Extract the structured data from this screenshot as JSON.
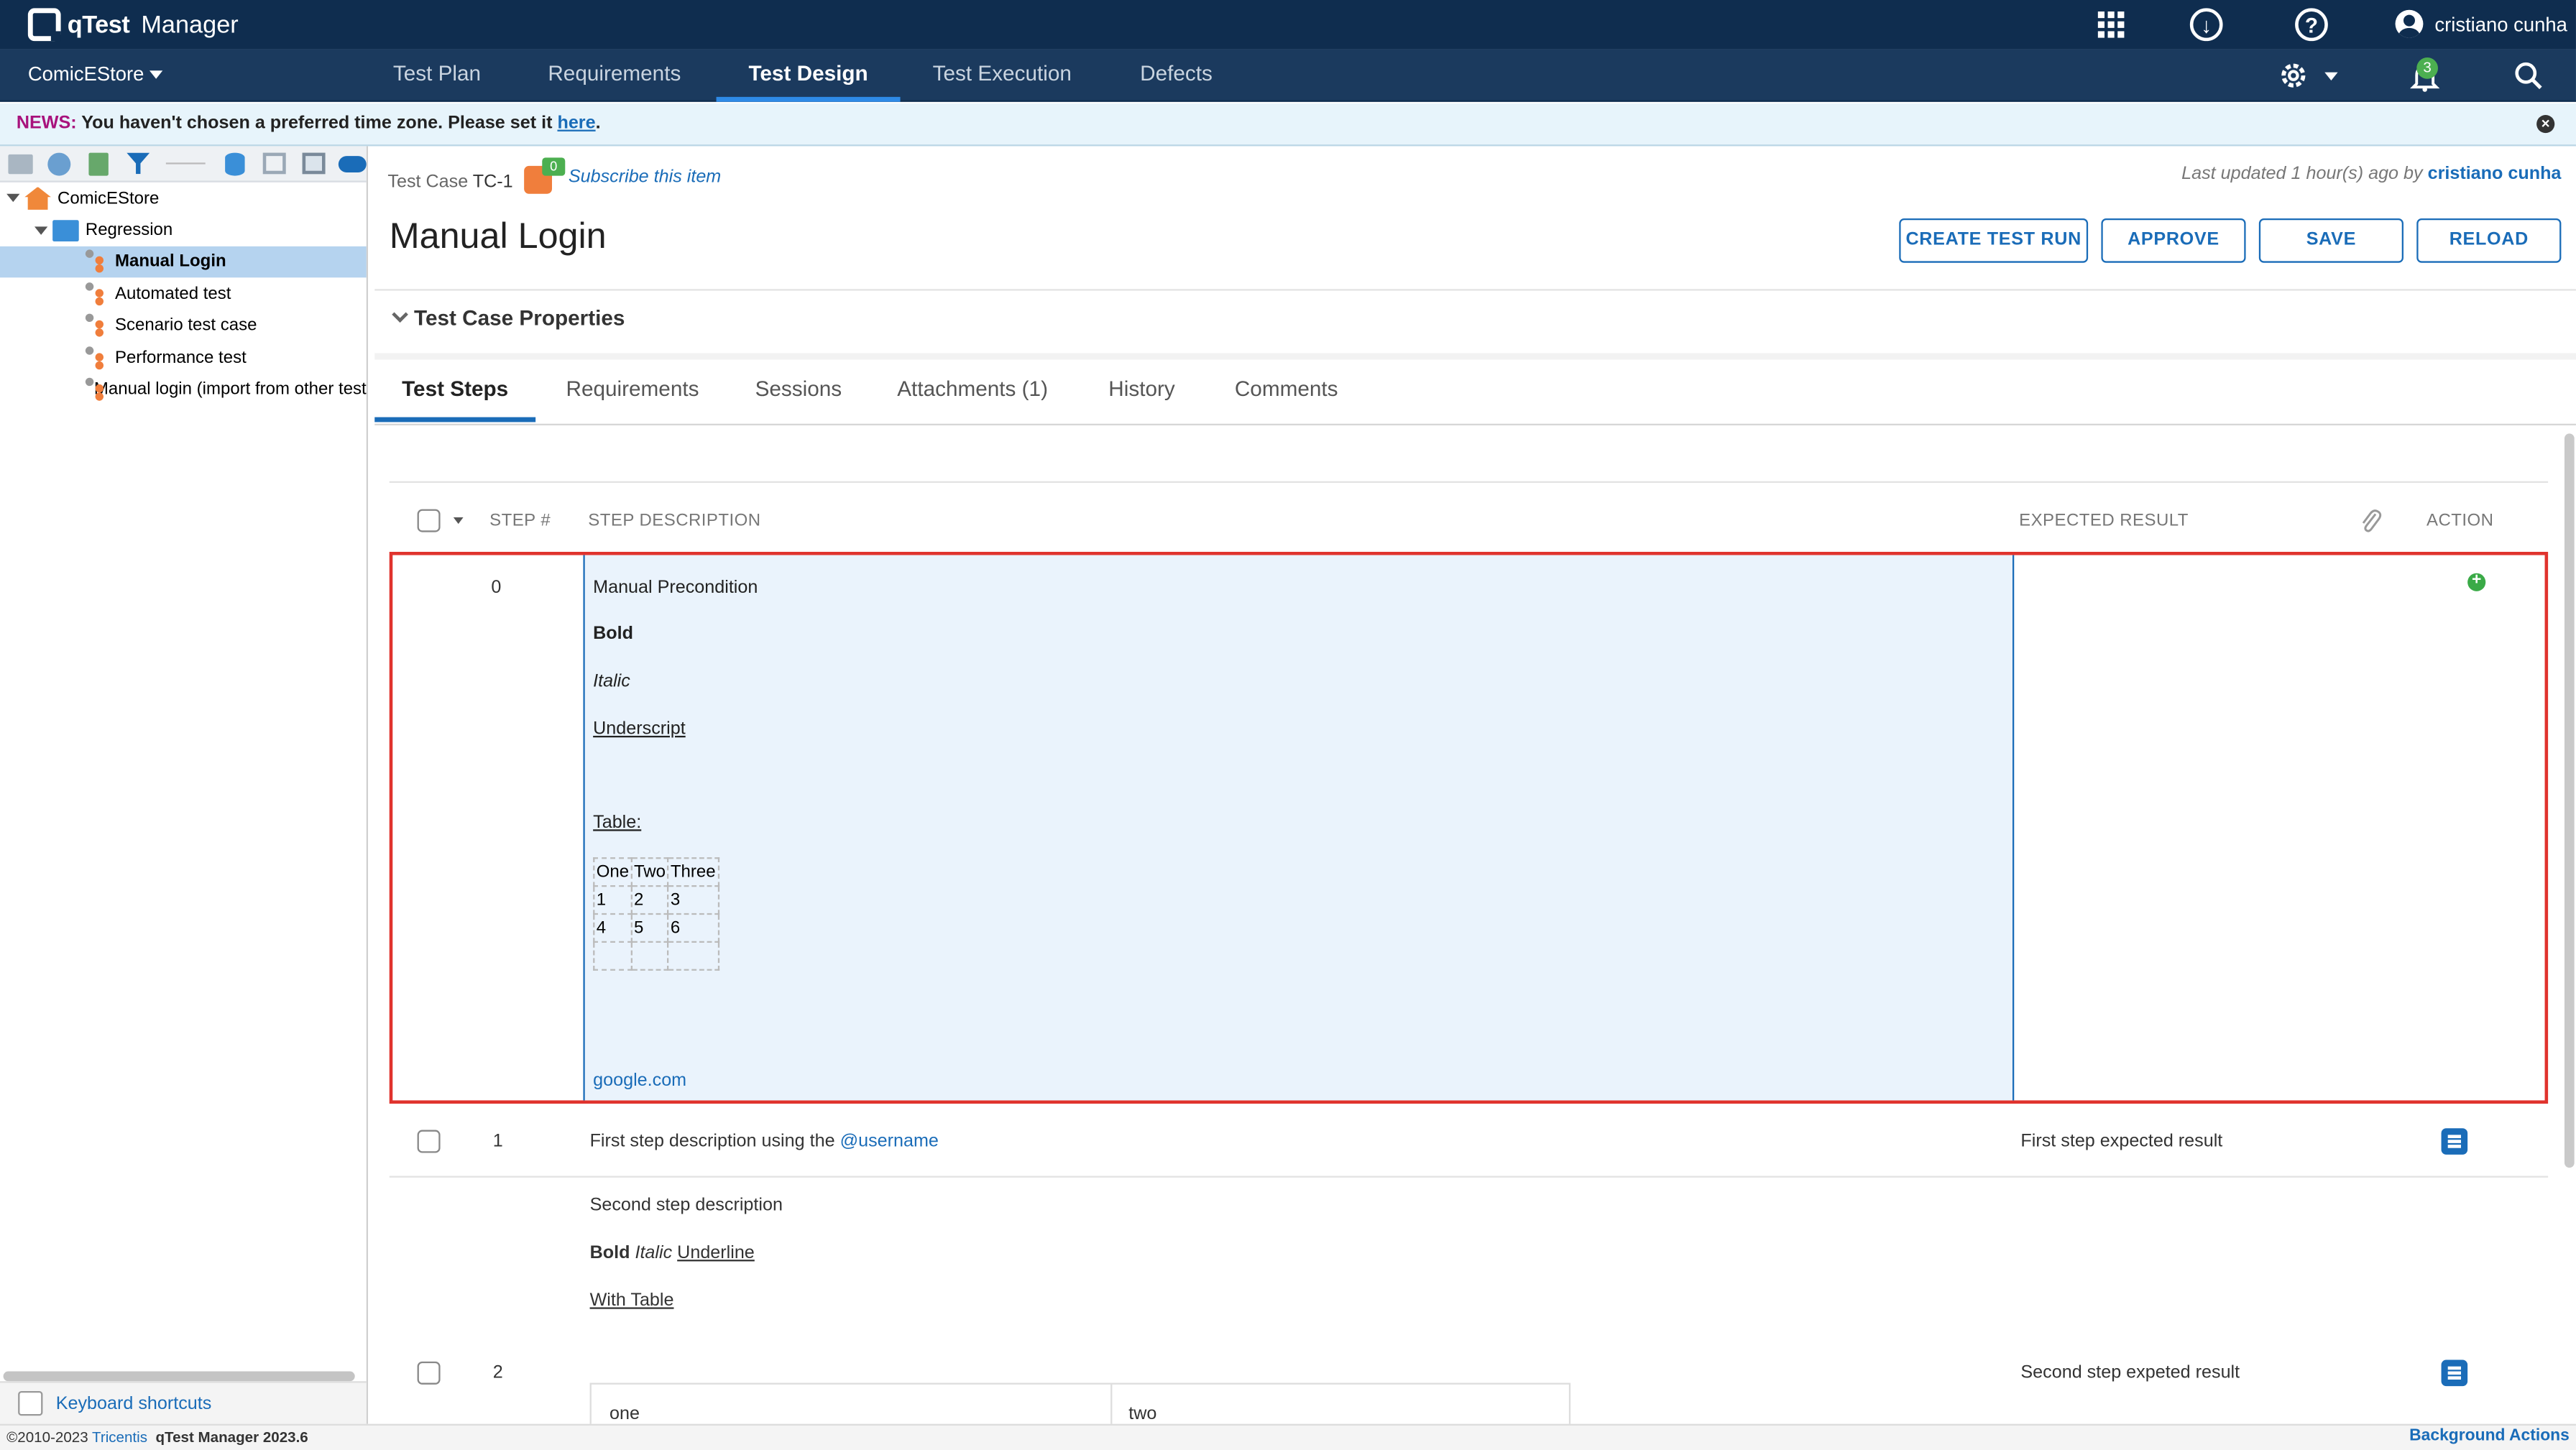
{
  "app": {
    "logo_text": "qTest",
    "product": "Manager"
  },
  "user": {
    "name": "cristiano cunha"
  },
  "nav": {
    "project": "ComicEStore",
    "tabs": [
      "Test Plan",
      "Requirements",
      "Test Design",
      "Test Execution",
      "Defects"
    ],
    "active_tab": "Test Design",
    "notifications_count": "3"
  },
  "news": {
    "label": "NEWS:",
    "text": "You haven't chosen a preferred time zone. Please set it",
    "link": "here",
    "suffix": "."
  },
  "tree": {
    "root": "ComicEStore",
    "folder": "Regression",
    "items": [
      "Manual Login",
      "Automated test",
      "Scenario test case",
      "Performance test",
      "Manual login (import from other test"
    ],
    "selected": "Manual Login"
  },
  "keyboard_shortcuts": "Keyboard shortcuts",
  "test_case": {
    "type_label": "Test Case",
    "id": "TC-1",
    "subscribe_count": "0",
    "subscribe_label": "Subscribe this item",
    "updated_prefix": "Last updated 1 hour(s) ago by",
    "updated_by": "cristiano cunha",
    "title": "Manual Login",
    "properties_label": "Test Case Properties"
  },
  "actions": {
    "create_test_run": "CREATE TEST RUN",
    "approve": "APPROVE",
    "save": "SAVE",
    "reload": "RELOAD"
  },
  "subtabs": [
    "Test Steps",
    "Requirements",
    "Sessions",
    "Attachments (1)",
    "History",
    "Comments"
  ],
  "steps_table": {
    "columns": {
      "step": "STEP #",
      "description": "STEP DESCRIPTION",
      "expected": "EXPECTED RESULT",
      "action": "ACTION"
    },
    "step0": {
      "number": "0",
      "lines": [
        "Manual Precondition",
        "Bold",
        "Italic",
        "Underscript",
        "Table:"
      ],
      "table": [
        [
          "One",
          "Two",
          "Three"
        ],
        [
          "1",
          "2",
          "3"
        ],
        [
          "4",
          "5",
          "6"
        ],
        [
          "",
          "",
          ""
        ]
      ],
      "link": "google.com"
    },
    "step1": {
      "number": "1",
      "description": "First step description using the",
      "mention": "@username",
      "expected": "First step expected result"
    },
    "step2": {
      "number": "2",
      "description": "Second step description",
      "bold": "Bold",
      "italic": "Italic",
      "underline": "Underline",
      "with_table": "With Table",
      "table_cells": [
        "one",
        "two"
      ],
      "expected": "Second step expeted result"
    }
  },
  "footer": {
    "copyright": "©2010-2023",
    "company": "Tricentis",
    "version": "qTest Manager 2023.6",
    "background_actions": "Background Actions"
  }
}
